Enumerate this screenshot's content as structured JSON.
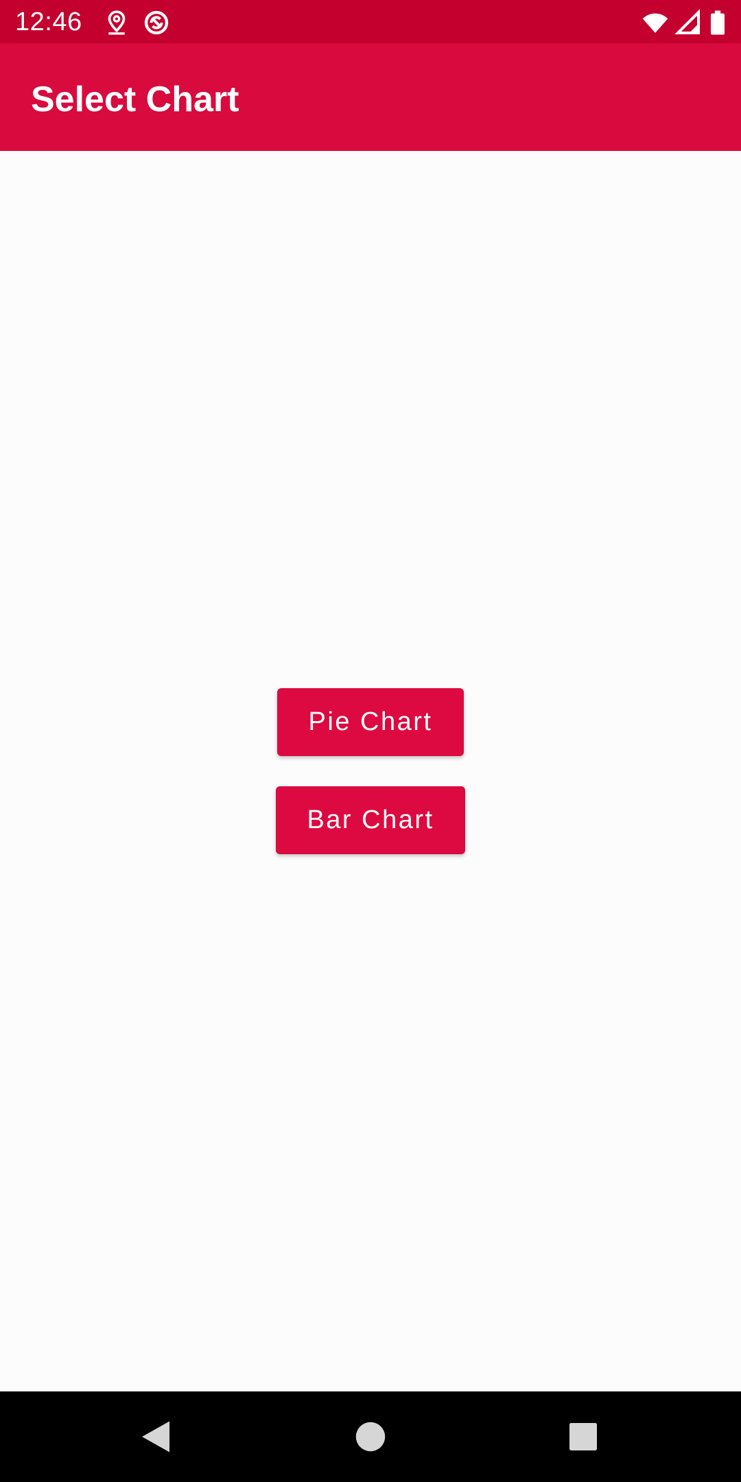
{
  "status_bar": {
    "time": "12:46",
    "icons": [
      "location-pin-icon",
      "sync-badge-icon",
      "wifi-icon",
      "signal-icon",
      "battery-icon"
    ]
  },
  "app_bar": {
    "title": "Select Chart"
  },
  "main": {
    "buttons": [
      {
        "label": "Pie Chart"
      },
      {
        "label": "Bar Chart"
      }
    ]
  },
  "nav_bar": {
    "buttons": [
      "back-icon",
      "home-icon",
      "recents-icon"
    ]
  },
  "colors": {
    "status_bar": "#c4002f",
    "app_bar": "#d90a3d",
    "button": "#dc0a40",
    "background": "#fcfcfc",
    "nav_bar": "#000000"
  }
}
